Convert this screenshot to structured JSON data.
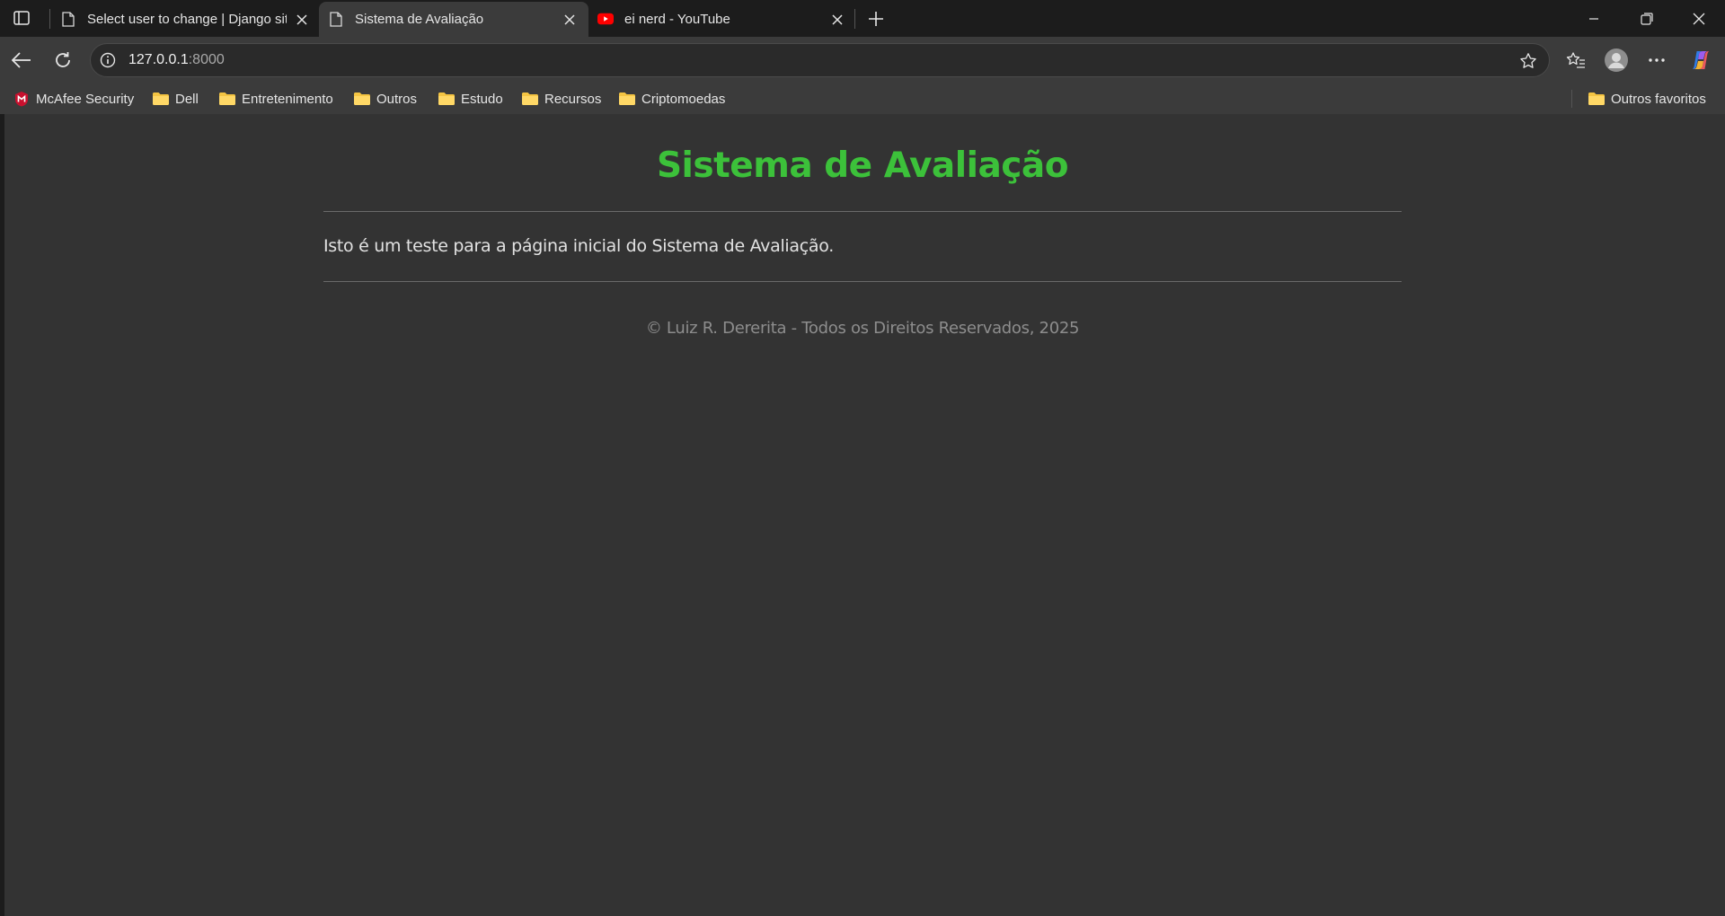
{
  "browser": {
    "tabs": [
      {
        "title": "Select user to change | Django site",
        "favicon": "page-icon",
        "active": false
      },
      {
        "title": "Sistema de Avaliação",
        "favicon": "page-icon",
        "active": true
      },
      {
        "title": "ei nerd - YouTube",
        "favicon": "youtube-icon",
        "active": false
      }
    ],
    "address": {
      "host": "127.0.0.1",
      "port": ":8000"
    },
    "bookmarks": [
      {
        "label": "McAfee Security",
        "icon": "mcafee-icon"
      },
      {
        "label": "Dell",
        "icon": "folder-icon"
      },
      {
        "label": "Entretenimento",
        "icon": "folder-icon"
      },
      {
        "label": "Outros",
        "icon": "folder-icon"
      },
      {
        "label": "Estudo",
        "icon": "folder-icon"
      },
      {
        "label": "Recursos",
        "icon": "folder-icon"
      },
      {
        "label": "Criptomoedas",
        "icon": "folder-icon"
      }
    ],
    "other_favorites": "Outros favoritos"
  },
  "page": {
    "title": "Sistema de Avaliação",
    "intro": "Isto é um teste para a página inicial do Sistema de Avaliação.",
    "footer": "© Luiz R. Dererita - Todos os Direitos Reservados, 2025"
  },
  "colors": {
    "title_green": "#3cc13a",
    "page_bg": "#333333",
    "chrome_bg": "#3b3b3b",
    "folder_yellow": "#f5c543",
    "youtube_red": "#ff0000"
  }
}
